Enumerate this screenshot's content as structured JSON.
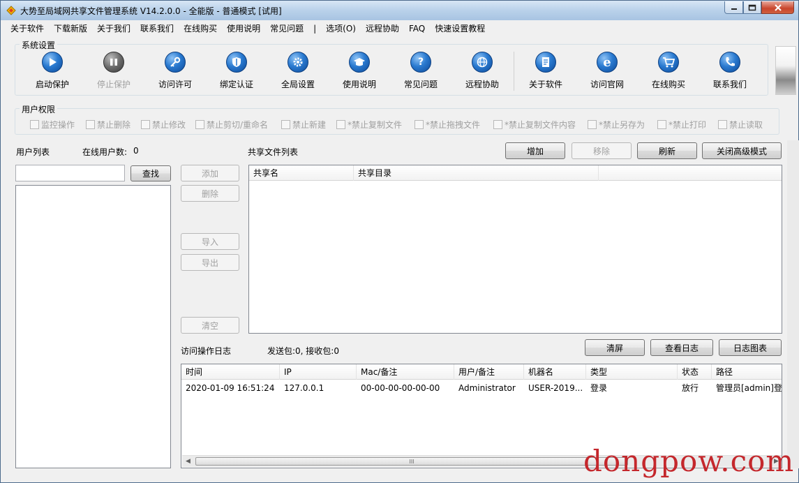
{
  "window": {
    "title": "大势至局域网共享文件管理系统 V14.2.0.0 - 全能版 - 普通模式 [试用]",
    "min_icon": "minimize-icon",
    "max_icon": "maximize-icon",
    "close_icon": "close-icon"
  },
  "menu": [
    "关于软件",
    "下载新版",
    "关于我们",
    "联系我们",
    "在线购买",
    "使用说明",
    "常见问题",
    "|",
    "选项(O)",
    "远程协助",
    "FAQ",
    "快速设置教程"
  ],
  "system_settings": {
    "label": "系统设置",
    "tools": [
      {
        "label": "启动保护",
        "icon": "play-icon",
        "enabled": true
      },
      {
        "label": "停止保护",
        "icon": "pause-icon",
        "enabled": false
      },
      {
        "label": "访问许可",
        "icon": "key-icon",
        "enabled": true
      },
      {
        "label": "绑定认证",
        "icon": "shield-icon",
        "enabled": true
      },
      {
        "label": "全局设置",
        "icon": "gear-icon",
        "enabled": true
      },
      {
        "label": "使用说明",
        "icon": "graduation-cap-icon",
        "enabled": true
      },
      {
        "label": "常见问题",
        "icon": "question-icon",
        "enabled": true
      },
      {
        "label": "远程协助",
        "icon": "globe-icon",
        "enabled": true
      },
      {
        "label": "关于软件",
        "icon": "document-icon",
        "enabled": true
      },
      {
        "label": "访问官网",
        "icon": "ie-icon",
        "enabled": true
      },
      {
        "label": "在线购买",
        "icon": "cart-icon",
        "enabled": true
      },
      {
        "label": "联系我们",
        "icon": "phone-icon",
        "enabled": true
      }
    ]
  },
  "user_permissions": {
    "label": "用户权限",
    "items": [
      "监控操作",
      "禁止删除",
      "禁止修改",
      "禁止剪切/重命名",
      "禁止新建",
      "*禁止复制文件",
      "*禁止拖拽文件",
      "*禁止复制文件内容",
      "*禁止另存为",
      "*禁止打印",
      "禁止读取"
    ]
  },
  "user_list": {
    "label": "用户列表",
    "online_label": "在线用户数:",
    "online_count": "0",
    "search_value": "",
    "search_button": "查找"
  },
  "user_actions": {
    "add": "添加",
    "delete": "删除",
    "import": "导入",
    "export": "导出",
    "clear": "清空"
  },
  "shared_files": {
    "label": "共享文件列表",
    "buttons": {
      "add": "增加",
      "remove": "移除",
      "refresh": "刷新",
      "close_advanced": "关闭高级模式"
    },
    "columns": [
      "共享名",
      "共享目录",
      ""
    ]
  },
  "access_log": {
    "label": "访问操作日志",
    "packets": "发送包:0, 接收包:0",
    "buttons": {
      "clear": "清屏",
      "view": "查看日志",
      "chart": "日志图表"
    },
    "columns": [
      "时间",
      "IP",
      "Mac/备注",
      "用户/备注",
      "机器名",
      "类型",
      "状态",
      "路径"
    ],
    "rows": [
      [
        "2020-01-09 16:51:24",
        "127.0.0.1",
        "00-00-00-00-00-00",
        "Administrator",
        "USER-2019...",
        "登录",
        "放行",
        "管理员[admin]登录"
      ]
    ],
    "scroll_grip": "III"
  },
  "watermark": "dongpow.com",
  "colors": {
    "title_bar": "#b9d1ea",
    "watermark": "#c4272c",
    "icon_blue": "#2a7ad0"
  }
}
